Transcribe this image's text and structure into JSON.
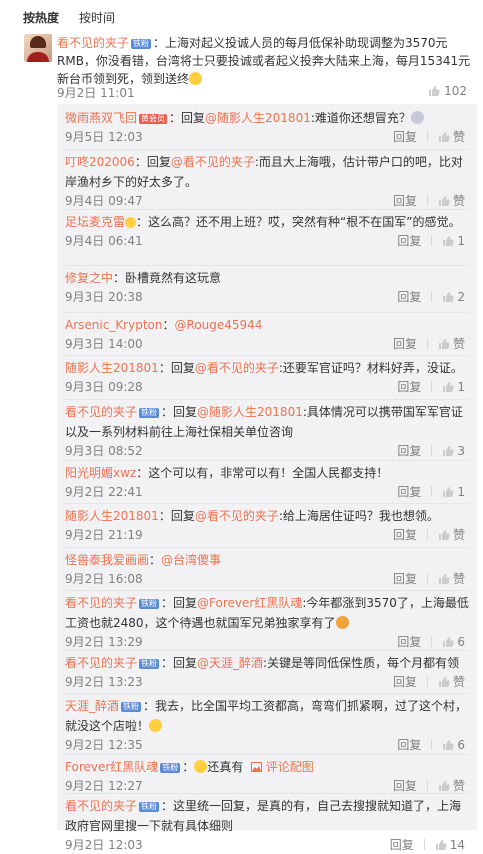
{
  "tabs": {
    "hot": "按热度",
    "time": "按时间"
  },
  "main": {
    "username": "看不见的夹子",
    "badge": "铁粉",
    "text": "：上海对起义投诚人员的每月低保补助现调整为3570元RMB，你没看错，台湾将士只要投诚或者起义投奔大陆来上海，每月15341元新台币领到死，领到送终",
    "date": "9月2日 11:01",
    "like_count": "102"
  },
  "replies": [
    {
      "user": "微雨燕双飞回",
      "badge": "黄会员",
      "badge_red": true,
      "pre": "：回复",
      "at": "@随影人生201801",
      "text": ":难道你还想冒充？",
      "date": "9月5日 12:03",
      "reply": "回复",
      "like": "赞",
      "user_color": "#eb7350"
    },
    {
      "user": "叮咚202006",
      "badge": "",
      "pre": "：回复",
      "at": "@看不见的夹子",
      "text": ":而且大上海哦，估计带户口的吧，比对岸渔村乡下的好太多了。",
      "date": "9月4日 09:47",
      "reply": "回复",
      "like": "赞"
    },
    {
      "user": "足坛麦克雷",
      "badge": "",
      "pre": "：这么高？还不用上班？哎，突然有种“根不在国军”的感觉。",
      "at": "",
      "text": "",
      "date": "9月4日 06:41",
      "reply": "回复",
      "like": "1"
    },
    {
      "user": "修复之中",
      "badge": "",
      "pre": "：卧槽竟然有这玩意",
      "at": "",
      "text": "",
      "date": "9月3日 20:38",
      "reply": "回复",
      "like": "2"
    },
    {
      "user": "Arsenic_Krypton",
      "badge": "",
      "pre": "：",
      "at": "@Rouge45944",
      "text": "",
      "date": "9月3日 14:00",
      "reply": "回复",
      "like": "赞"
    },
    {
      "user": "随影人生201801",
      "badge": "",
      "pre": "：回复",
      "at": "@看不见的夹子",
      "text": ":还要军官证吗？材料好弄，没证。",
      "date": "9月3日 09:28",
      "reply": "回复",
      "like": "1"
    },
    {
      "user": "看不见的夹子",
      "badge": "铁粉",
      "pre": "：回复",
      "at": "@随影人生201801",
      "text": ":具体情况可以携带国军军官证以及一系列材料前往上海社保相关单位咨询",
      "date": "9月3日 08:52",
      "reply": "回复",
      "like": "3"
    },
    {
      "user": "阳光明媚xwz",
      "badge": "",
      "pre": "：这个可以有，非常可以有！全国人民都支持！",
      "at": "",
      "text": "",
      "date": "9月2日 22:41",
      "reply": "回复",
      "like": "1"
    },
    {
      "user": "随影人生201801",
      "badge": "",
      "pre": "：回复",
      "at": "@看不见的夹子",
      "text": ":给上海居住证吗？我也想领。",
      "date": "9月2日 21:19",
      "reply": "回复",
      "like": "赞"
    },
    {
      "user": "怪兽泰我爱画画",
      "badge": "",
      "pre": "：",
      "at": "@台湾傻事",
      "text": "",
      "date": "9月2日 16:08",
      "reply": "回复",
      "like": "赞"
    },
    {
      "user": "看不见的夹子",
      "badge": "铁粉",
      "pre": "：回复",
      "at": "@Forever红黑队魂",
      "text": ":今年都涨到3570了，上海最低工资也就2480，这个待遇也就国军兄弟独家享有了",
      "date": "9月2日 13:29",
      "reply": "回复",
      "like": "6"
    },
    {
      "user": "看不见的夹子",
      "badge": "铁粉",
      "pre": "：回复",
      "at": "@天涯_醉酒",
      "text": ":关键是等同低保性质，每个月都有领",
      "date": "9月2日 13:23",
      "reply": "回复",
      "like": "赞"
    },
    {
      "user": "天涯_醉酒",
      "badge": "铁粉",
      "pre": "：我去，比全国平均工资都高，弯弯们抓紧啊，过了这个村，就没这个店啦！",
      "at": "",
      "text": "",
      "date": "9月2日 12:35",
      "reply": "回复",
      "like": "6"
    },
    {
      "user": "Forever红黑队魂",
      "badge": "铁粉",
      "pre": "：",
      "at": "",
      "text": "还真有",
      "pic": "评论配图",
      "date": "9月2日 12:27",
      "reply": "回复",
      "like": "赞"
    },
    {
      "user": "看不见的夹子",
      "badge": "铁粉",
      "pre": "：这里统一回复，是真的有，自己去搜搜就知道了，上海政府官网里搜一下就有具体细则",
      "at": "",
      "text": "",
      "date": "9月2日 12:03",
      "reply": "回复",
      "like": "14"
    }
  ]
}
